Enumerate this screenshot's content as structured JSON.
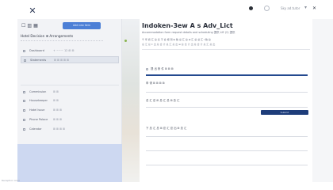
{
  "app": {
    "logo_glyph": "✕"
  },
  "topbar": {
    "user_label": "Sky ad.tutor",
    "dropdown_glyph": "▾",
    "close_glyph": "✕"
  },
  "sidebar": {
    "toolbar": [
      "☐",
      "▥",
      "▦"
    ],
    "action_label": "Add new item",
    "heading": "Hotel Decision ⊕ Arrangements",
    "items": [
      {
        "label": "Dashboard",
        "value": "+ ~~~ 12 ⊞ ⊞",
        "active": false
      },
      {
        "label": "Statements",
        "value": "⊞ ⊞ ⊞ ⊞ ⊞",
        "active": true
      },
      {
        "label": "Commission",
        "value": "⊞ ⊞",
        "active": false
      },
      {
        "label": "Housekeeper",
        "value": "⊞ ⊞",
        "active": false
      },
      {
        "label": "Hotel Issue",
        "value": "⊞ ⊞ ⊞",
        "active": false
      },
      {
        "label": "Phone Palace",
        "value": "⊞ ⊞ ⊞",
        "active": false
      },
      {
        "label": "Calendar",
        "value": "⊞ ⊞ ⊞ ⊞",
        "active": false
      }
    ],
    "footer": "Reception Area"
  },
  "main": {
    "title": "Indoken-3ew A s Adv_Lict",
    "subtitle": "Accommodation form request details and scheduling 提供 LIE (2) 提供",
    "meta_line": "千 年 终 汇 总 表   不 合 规 则           ⊞ 数 总 汇 总        ⊞ 汇 总 总 汇 Ι 数 总",
    "meta_line2": "总 汇 总 Σ 出 总 合 计 总 汇 总 出 ⊞ 总 合 计 出 总 合 计 总 汇 总 出",
    "sections": [
      {
        "label": "提 出 条 件  ⊞ ⊞ ⊞"
      },
      {
        "label": "申 请 ⊞ ⊞ ⊞ ⊞"
      },
      {
        "label": "总 汇 总 ⊞ 总 汇 总 ⊞ 总 汇"
      },
      {
        "label": "下 总 汇 总 ⊞ 总 汇 总 出 ⊞ 总 汇"
      }
    ],
    "progress_fraction": 1.0,
    "submit_label": "Submit"
  },
  "colors": {
    "accent": "#4c7fd6",
    "primary_dark": "#1e3d7a",
    "panel_blue": "#cdd8f1",
    "sidebar_bg": "#f2f3f6"
  }
}
